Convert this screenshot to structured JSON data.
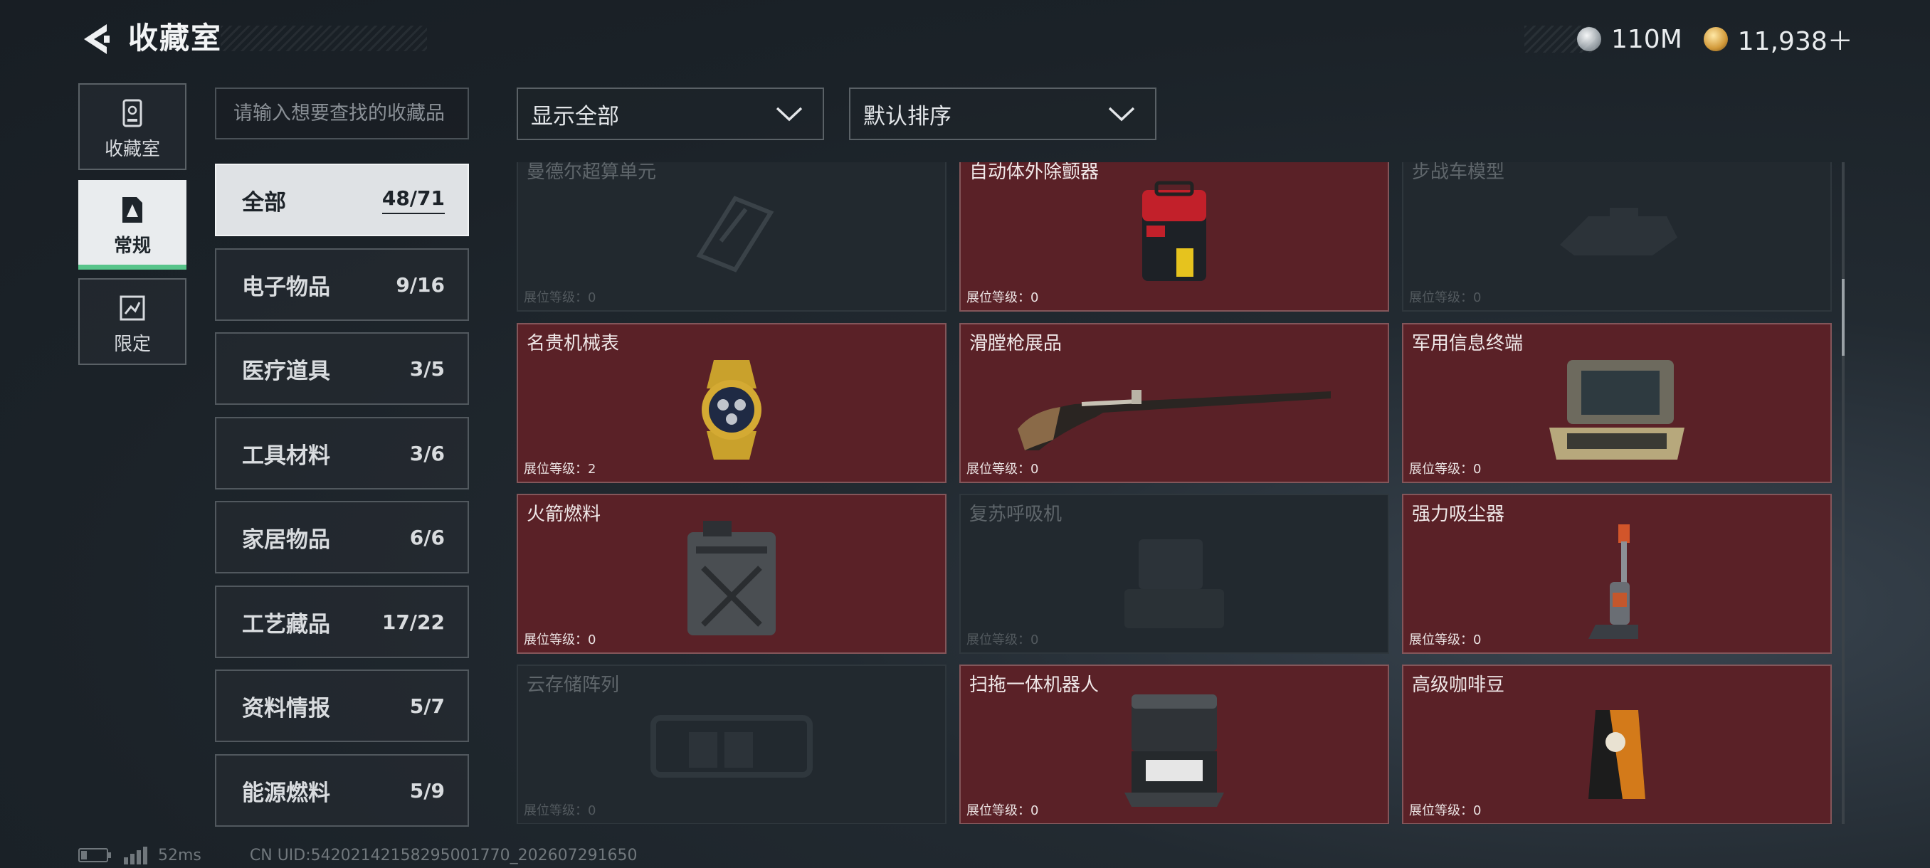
{
  "header": {
    "title": "收藏室",
    "currency_a": "110M",
    "currency_b": "11,938＋"
  },
  "nav": [
    {
      "label": "收藏室"
    },
    {
      "label": "常规"
    },
    {
      "label": "限定"
    }
  ],
  "search": {
    "placeholder": "请输入想要查找的收藏品"
  },
  "filters": {
    "show": "显示全部",
    "sort": "默认排序"
  },
  "categories": [
    {
      "name": "全部",
      "count": "48/71"
    },
    {
      "name": "电子物品",
      "count": "9/16"
    },
    {
      "name": "医疗道具",
      "count": "3/5"
    },
    {
      "name": "工具材料",
      "count": "3/6"
    },
    {
      "name": "家居物品",
      "count": "6/6"
    },
    {
      "name": "工艺藏品",
      "count": "17/22"
    },
    {
      "name": "资料情报",
      "count": "5/7"
    },
    {
      "name": "能源燃料",
      "count": "5/9"
    }
  ],
  "level_label": "展位等级：",
  "items": [
    {
      "name": "曼德尔超算单元",
      "level": "0",
      "owned": false
    },
    {
      "name": "自动体外除颤器",
      "level": "0",
      "owned": true
    },
    {
      "name": "步战车模型",
      "level": "0",
      "owned": false
    },
    {
      "name": "名贵机械表",
      "level": "2",
      "owned": true
    },
    {
      "name": "滑膛枪展品",
      "level": "0",
      "owned": true
    },
    {
      "name": "军用信息终端",
      "level": "0",
      "owned": true
    },
    {
      "name": "火箭燃料",
      "level": "0",
      "owned": true
    },
    {
      "name": "复苏呼吸机",
      "level": "0",
      "owned": false
    },
    {
      "name": "强力吸尘器",
      "level": "0",
      "owned": true
    },
    {
      "name": "云存储阵列",
      "level": "0",
      "owned": false
    },
    {
      "name": "扫拖一体机器人",
      "level": "0",
      "owned": true
    },
    {
      "name": "高级咖啡豆",
      "level": "0",
      "owned": true
    }
  ],
  "footer": {
    "ping": "52ms",
    "uid": "CN UID:54202142158295001770_202607291650"
  },
  "colors": {
    "owned_card": "#5a2127",
    "locked_card": "#22292f",
    "active_tab_bar": "#57c48a"
  }
}
